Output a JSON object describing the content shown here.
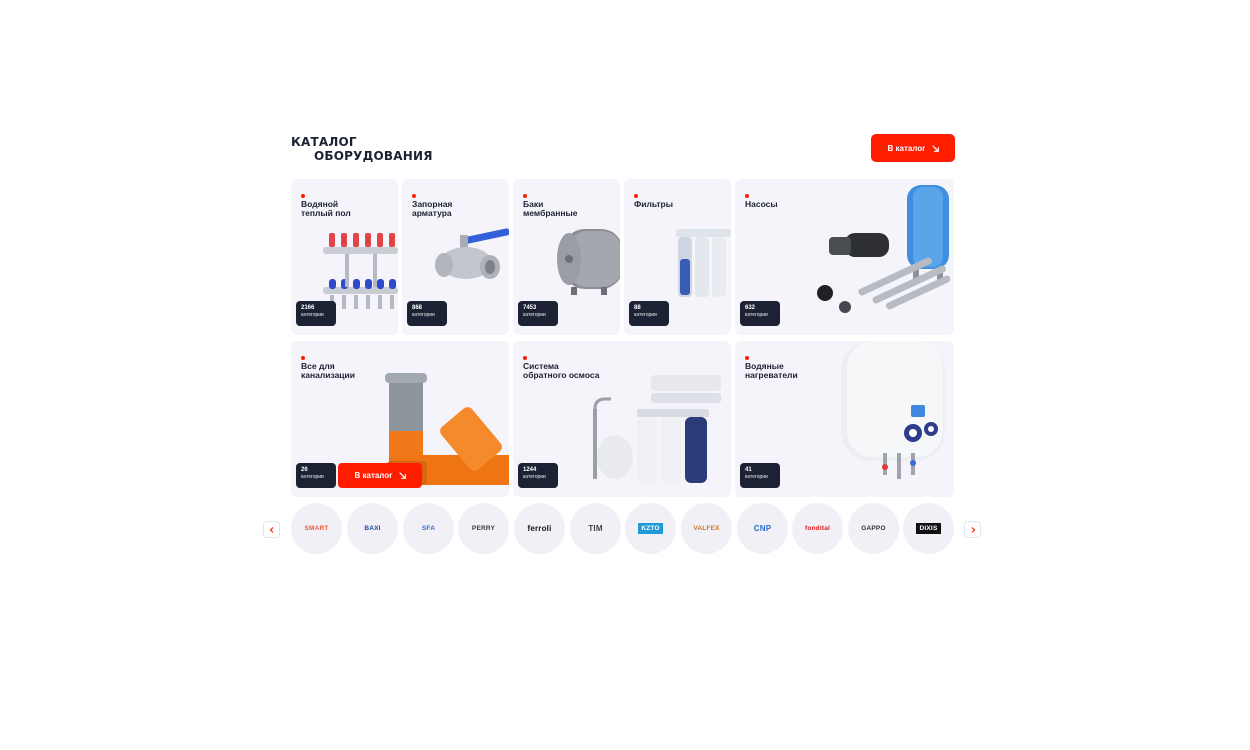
{
  "header": {
    "title_line1": "КАТАЛОГ",
    "title_line2": "ОБОРУДОВАНИЯ",
    "catalog_button": "В каталог"
  },
  "categories": [
    {
      "title": "Водяной\nтеплый пол",
      "count": "2166",
      "unit": "категории"
    },
    {
      "title": "Запорная\nарматура",
      "count": "868",
      "unit": "категории"
    },
    {
      "title": "Баки\nмембранные",
      "count": "7453",
      "unit": "категории"
    },
    {
      "title": "Фильтры",
      "count": "88",
      "unit": "категории"
    },
    {
      "title": "Насосы",
      "count": "632",
      "unit": "категории"
    },
    {
      "title": "Все для\nканализации",
      "count": "26",
      "unit": "категории",
      "button": "В каталог"
    },
    {
      "title": "Система\nобратного осмоса",
      "count": "1244",
      "unit": "категории"
    },
    {
      "title": "Водяные\nнагреватели",
      "count": "41",
      "unit": "категории"
    }
  ],
  "brands": [
    {
      "label": "SMART",
      "color": "#e8603c"
    },
    {
      "label": "BAXI",
      "color": "#1e4ca0"
    },
    {
      "label": "SFA",
      "color": "#2f6fc0"
    },
    {
      "label": "PERRY",
      "color": "#3b3b3b"
    },
    {
      "label": "ferroli",
      "color": "#111111"
    },
    {
      "label": "TIM",
      "color": "#444444"
    },
    {
      "label": "KZTO",
      "color": "#1f9bd7"
    },
    {
      "label": "VALFEX",
      "color": "#c8782e"
    },
    {
      "label": "CNP",
      "color": "#2b6fc2"
    },
    {
      "label": "fondital",
      "color": "#d81f1f"
    },
    {
      "label": "GAPPO",
      "color": "#333333"
    },
    {
      "label": "DIXIS",
      "color": "#111111"
    }
  ],
  "colors": {
    "accent": "#ff1d00",
    "dark": "#1c2233",
    "card_bg": "#f5f4fa"
  },
  "icons": {
    "prev": "chevron-left-icon",
    "next": "chevron-right-icon",
    "go": "arrow-down-right-icon"
  }
}
